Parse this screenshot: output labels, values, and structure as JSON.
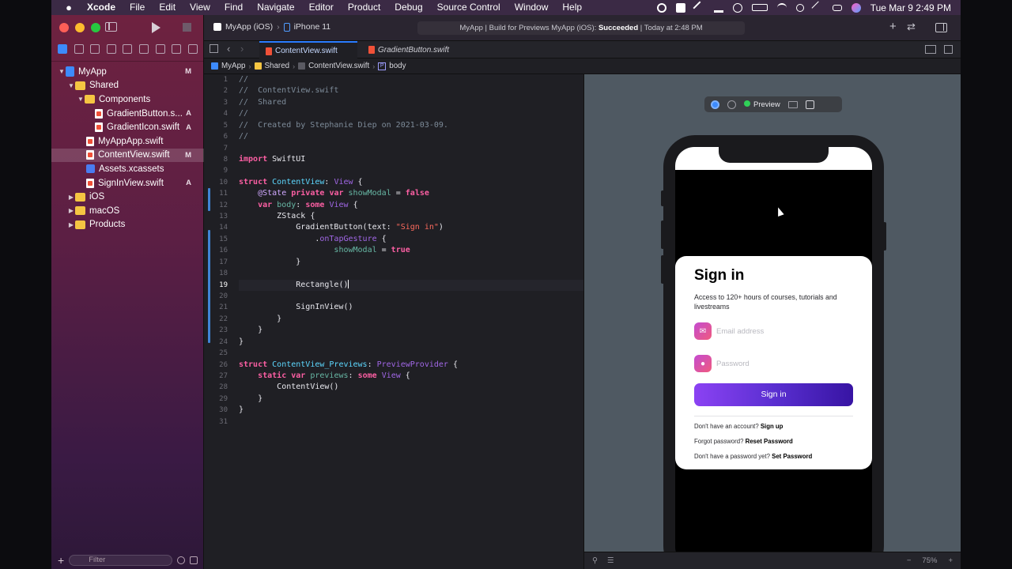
{
  "menubar": {
    "apple": "",
    "app": "Xcode",
    "items": [
      "File",
      "Edit",
      "View",
      "Find",
      "Navigate",
      "Editor",
      "Product",
      "Debug",
      "Source Control",
      "Window",
      "Help"
    ],
    "clock": "Tue Mar 9  2:49 PM"
  },
  "toolbar": {
    "scheme": "MyApp (iOS)",
    "device": "iPhone 11",
    "status_prefix": "MyApp | Build for Previews MyApp (iOS): ",
    "status_result": "Succeeded",
    "status_suffix": " | Today at 2:48 PM"
  },
  "tabs": [
    {
      "label": "ContentView.swift"
    },
    {
      "label": "GradientButton.swift"
    }
  ],
  "jumpbar": {
    "items": [
      "MyApp",
      "Shared",
      "ContentView.swift",
      "body"
    ]
  },
  "navigator": {
    "rows": [
      {
        "label": "MyApp",
        "badge": "M"
      },
      {
        "label": "Shared",
        "badge": ""
      },
      {
        "label": "Components",
        "badge": ""
      },
      {
        "label": "GradientButton.s...",
        "badge": "A"
      },
      {
        "label": "GradientIcon.swift",
        "badge": "A"
      },
      {
        "label": "MyAppApp.swift",
        "badge": ""
      },
      {
        "label": "ContentView.swift",
        "badge": "M"
      },
      {
        "label": "Assets.xcassets",
        "badge": ""
      },
      {
        "label": "SignInView.swift",
        "badge": "A"
      },
      {
        "label": "iOS",
        "badge": ""
      },
      {
        "label": "macOS",
        "badge": ""
      },
      {
        "label": "Products",
        "badge": ""
      }
    ],
    "filter_placeholder": "Filter"
  },
  "code": {
    "line_numbers": [
      "1",
      "2",
      "3",
      "4",
      "5",
      "6",
      "7",
      "8",
      "9",
      "10",
      "11",
      "12",
      "13",
      "14",
      "15",
      "16",
      "17",
      "18",
      "19",
      "20",
      "21",
      "22",
      "23",
      "24",
      "25",
      "26",
      "27",
      "28",
      "29",
      "30",
      "31"
    ],
    "l1": "//",
    "l2": "//  ContentView.swift",
    "l3": "//  Shared",
    "l4": "//",
    "l5": "//  Created by Stephanie Diep on 2021-03-09.",
    "l6": "//",
    "l8_kw": "import",
    "l8_rest": " SwiftUI",
    "l10_kw": "struct",
    "l10_name": "ContentView",
    "l10_colon": ": ",
    "l10_type": "View",
    "l10_brace": " {",
    "l11_indent": "    ",
    "l11_attr": "@State",
    "l11_kw1": "private",
    "l11_kw2": "var",
    "l11_name": "showModal",
    "l11_eq": " = ",
    "l11_val": "false",
    "l12_kw": "var",
    "l12_name": "body",
    "l12_colon": ": ",
    "l12_kw2": "some",
    "l12_type": "View",
    "l12_brace": " {",
    "l13_fn": "ZStack",
    "l13_brace": " {",
    "l14_fn": "GradientButton",
    "l14_arg": "(text: ",
    "l14_str": "\"Sign in\"",
    "l14_close": ")",
    "l15_dot": ".",
    "l15_fn": "onTapGesture",
    "l15_brace": " {",
    "l16_name": "showModal",
    "l16_eq": " = ",
    "l16_val": "true",
    "l17": "}",
    "l19_fn": "Rectangle",
    "l19_paren": "()",
    "l21_fn": "SignInView",
    "l21_paren": "()",
    "l22": "}",
    "l23": "}",
    "l24": "}",
    "l26_kw": "struct",
    "l26_name": "ContentView_Previews",
    "l26_colon": ": ",
    "l26_type": "PreviewProvider",
    "l26_brace": " {",
    "l27_kw1": "static",
    "l27_kw2": "var",
    "l27_name": "previews",
    "l27_colon": ": ",
    "l27_kw3": "some",
    "l27_type": "View",
    "l27_brace": " {",
    "l28_fn": "ContentView",
    "l28_paren": "()",
    "l29": "}",
    "l30": "}"
  },
  "preview": {
    "label": "Preview",
    "zoom": "75%",
    "card": {
      "title": "Sign in",
      "subtitle": "Access to 120+ hours of courses, tutorials and livestreams",
      "email_placeholder": "Email address",
      "password_placeholder": "Password",
      "button": "Sign in",
      "row1_text": "Don't have an account? ",
      "row1_link": "Sign up",
      "row2_text": "Forgot password? ",
      "row2_link": "Reset Password",
      "row3_text": "Don't have a password yet? ",
      "row3_link": "Set Password"
    }
  },
  "colors": {
    "accent": "#2a7cff",
    "sidebar_top": "#6e2240",
    "button_gradient_start": "#8b42f3",
    "button_gradient_end": "#3714a3",
    "keyword": "#fc5fa3",
    "type": "#5dd8ff",
    "string": "#fc6a5d",
    "comment": "#7d8b99"
  }
}
